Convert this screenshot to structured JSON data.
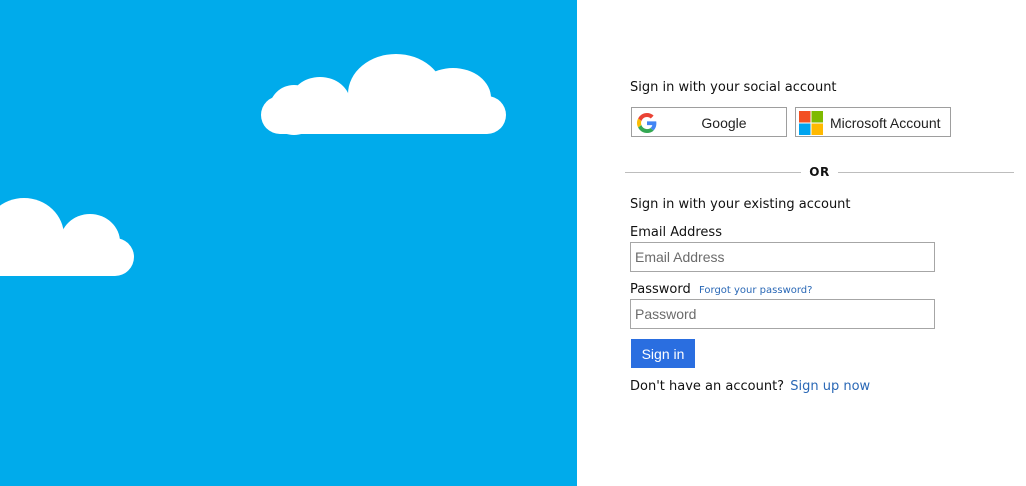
{
  "colors": {
    "sky": "#00abeb",
    "cloud": "#ffffff",
    "accent": "#2a6ee0",
    "link": "#2a68b6"
  },
  "social": {
    "heading": "Sign in with your social account",
    "google": {
      "label": "Google",
      "icon": "google-g-logo"
    },
    "microsoft": {
      "label": "Microsoft Account",
      "icon": "microsoft-four-squares-logo"
    }
  },
  "divider": {
    "text": "OR"
  },
  "local": {
    "heading": "Sign in with your existing account",
    "email_label": "Email Address",
    "email_placeholder": "Email Address",
    "email_value": "",
    "password_label": "Password",
    "password_placeholder": "Password",
    "password_value": "",
    "forgot_password": "Forgot your password?",
    "signin_button": "Sign in"
  },
  "signup": {
    "prompt": "Don't have an account?",
    "link": "Sign up now"
  }
}
